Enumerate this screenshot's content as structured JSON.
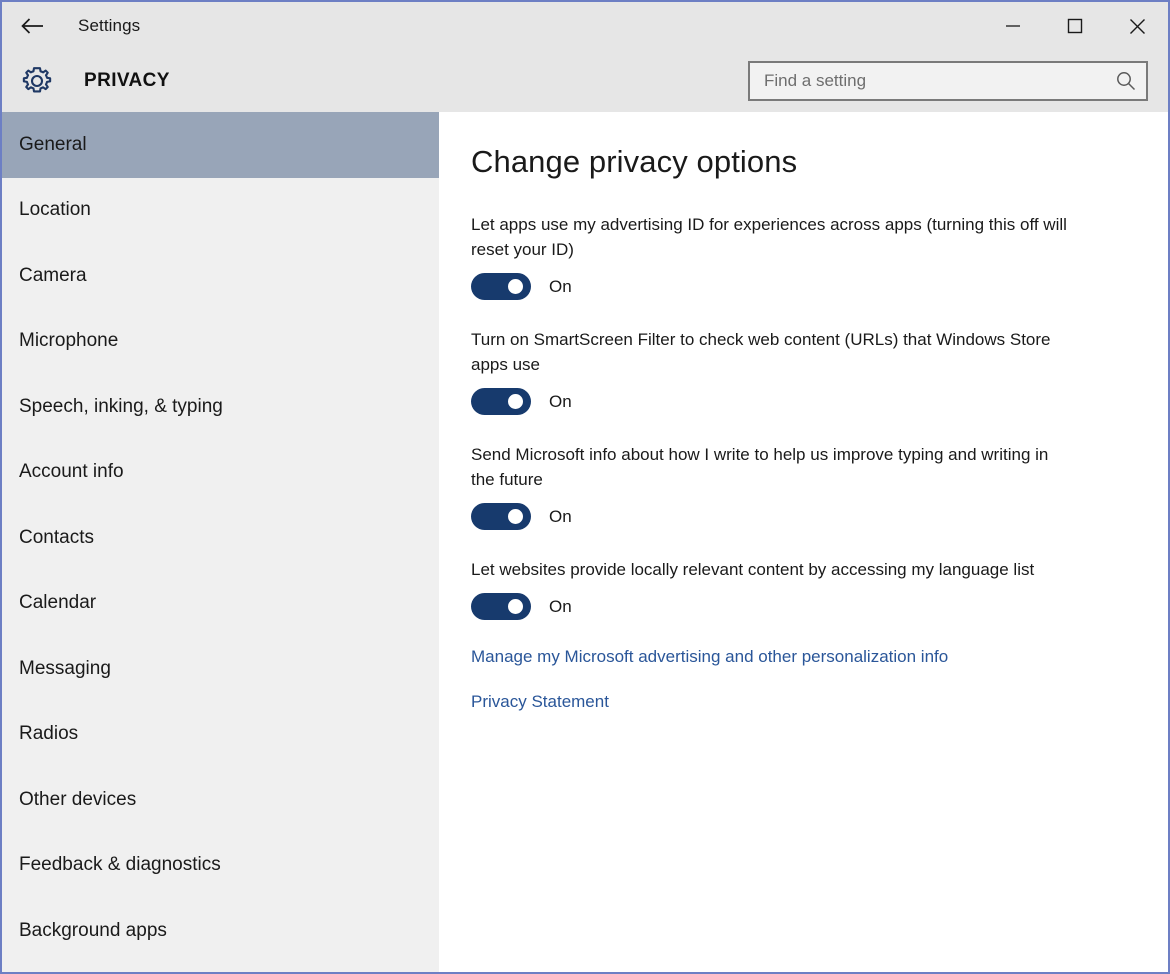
{
  "window": {
    "titlebar": {
      "back_icon": "back-arrow-icon",
      "title": "Settings",
      "minimize_label": "—",
      "maximize_label": "□",
      "close_label": "✕"
    },
    "border_color": "#6d7fc4",
    "chrome_color": "#e6e6e6"
  },
  "header": {
    "gear_icon": "gear-icon",
    "title": "PRIVACY",
    "search": {
      "placeholder": "Find a setting",
      "value": "",
      "icon": "search-icon"
    }
  },
  "sidebar": {
    "selected": "General",
    "selected_color": "#98a5b8",
    "background_color": "#f0f0f0",
    "items": [
      {
        "label": "General"
      },
      {
        "label": "Location"
      },
      {
        "label": "Camera"
      },
      {
        "label": "Microphone"
      },
      {
        "label": "Speech, inking, & typing"
      },
      {
        "label": "Account info"
      },
      {
        "label": "Contacts"
      },
      {
        "label": "Calendar"
      },
      {
        "label": "Messaging"
      },
      {
        "label": "Radios"
      },
      {
        "label": "Other devices"
      },
      {
        "label": "Feedback & diagnostics"
      },
      {
        "label": "Background apps"
      }
    ]
  },
  "main": {
    "heading": "Change privacy options",
    "accent_color": "#173a6d",
    "link_color": "#2a5699",
    "settings": [
      {
        "label": "Let apps use my advertising ID for experiences across apps (turning this off will reset your ID)",
        "state": "On"
      },
      {
        "label": "Turn on SmartScreen Filter to check web content (URLs) that Windows Store apps use",
        "state": "On"
      },
      {
        "label": "Send Microsoft info about how I write to help us improve typing and writing in the future",
        "state": "On"
      },
      {
        "label": "Let websites provide locally relevant content by accessing my language list",
        "state": "On"
      }
    ],
    "links": [
      {
        "label": "Manage my Microsoft advertising and other personalization info"
      },
      {
        "label": "Privacy Statement"
      }
    ]
  }
}
